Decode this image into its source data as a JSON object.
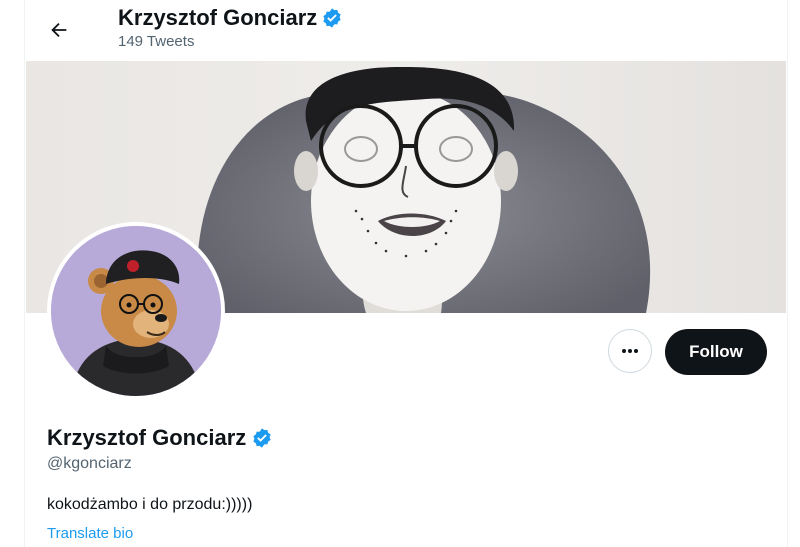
{
  "header": {
    "back_icon": "arrow-left-icon",
    "name": "Krzysztof Gonciarz",
    "tweet_count": "149 Tweets",
    "verified_icon": "verified-badge-icon"
  },
  "profile": {
    "name": "Krzysztof Gonciarz",
    "handle": "@kgonciarz",
    "bio": "kokodżambo i do przodu:)))))",
    "translate_label": "Translate bio",
    "follow_label": "Follow",
    "more_icon": "more-dots-icon",
    "verified_icon": "verified-badge-icon"
  },
  "colors": {
    "accent": "#1d9bf0",
    "follow_bg": "#0f1419",
    "secondary_text": "#536471",
    "avatar_bg": "#b7aad9"
  }
}
